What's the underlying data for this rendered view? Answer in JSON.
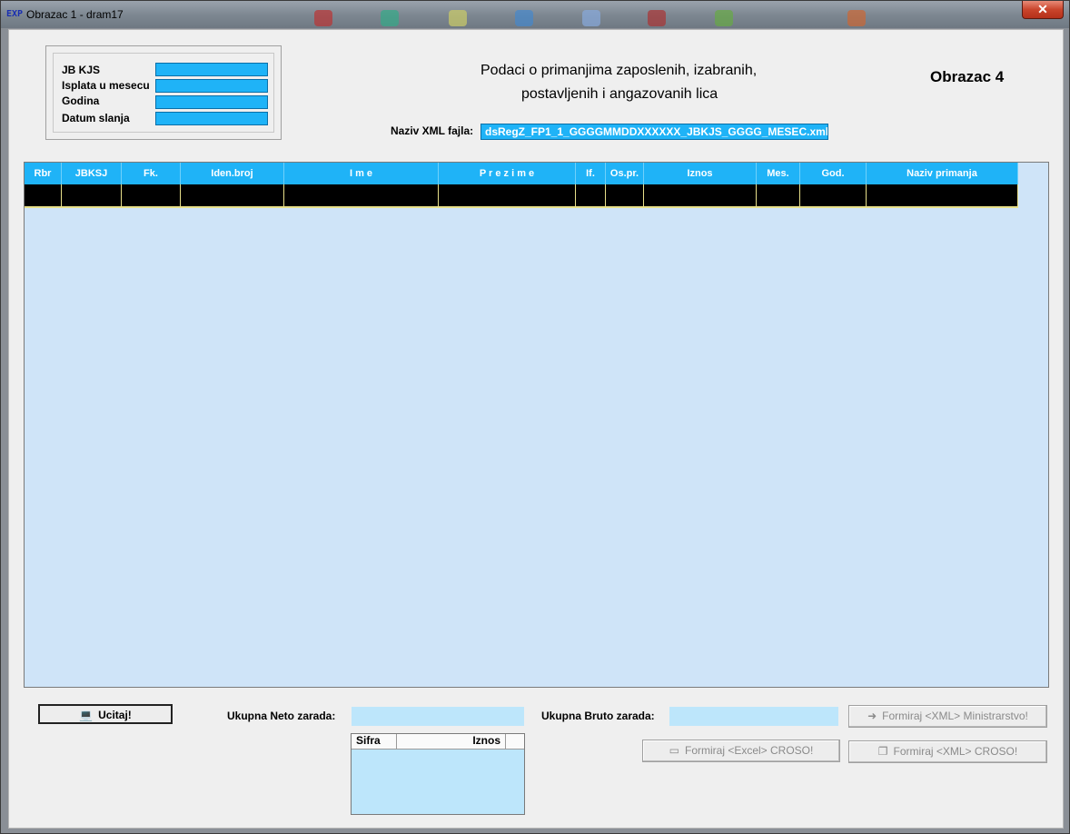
{
  "window": {
    "title": "Obrazac 1 - dram17",
    "close_label": "✕",
    "app_icon_text": "EXP"
  },
  "info": {
    "jb_kjs_label": "JB KJS",
    "isplata_label": "Isplata u mesecu",
    "godina_label": "Godina",
    "datum_label": "Datum slanja"
  },
  "heading": {
    "line1": "Podaci o primanjima zaposlenih, izabranih,",
    "line2": "postavljenih i angazovanih lica",
    "form_title": "Obrazac 4"
  },
  "xml": {
    "label": "Naziv XML fajla:",
    "filename": "dsRegZ_FP1_1_GGGGMMDDXXXXXX_JBKJS_GGGG_MESEC.xml"
  },
  "grid": {
    "columns": [
      "Rbr",
      "JBKSJ",
      "Fk.",
      "Iden.broj",
      "I m e",
      "P r e z i m e",
      "If.",
      "Os.pr.",
      "Iznos",
      "Mes.",
      "God.",
      "Naziv primanja"
    ]
  },
  "footer": {
    "ucitaj_label": "Ucitaj!",
    "neto_label": "Ukupna Neto zarada:",
    "bruto_label": "Ukupna Bruto zarada:",
    "xml_ministarstvo_label": "Formiraj <XML> Ministrarstvo!",
    "excel_croso_label": "Formiraj <Excel> CROSO!",
    "xml_croso_label": "Formiraj <XML> CROSO!",
    "mini_table": {
      "col1": "Sifra",
      "col2": "Iznos"
    }
  },
  "colors": {
    "accent_blue": "#1fb3f7",
    "grid_background": "#cfe4f8",
    "light_field": "#bde6fb"
  }
}
